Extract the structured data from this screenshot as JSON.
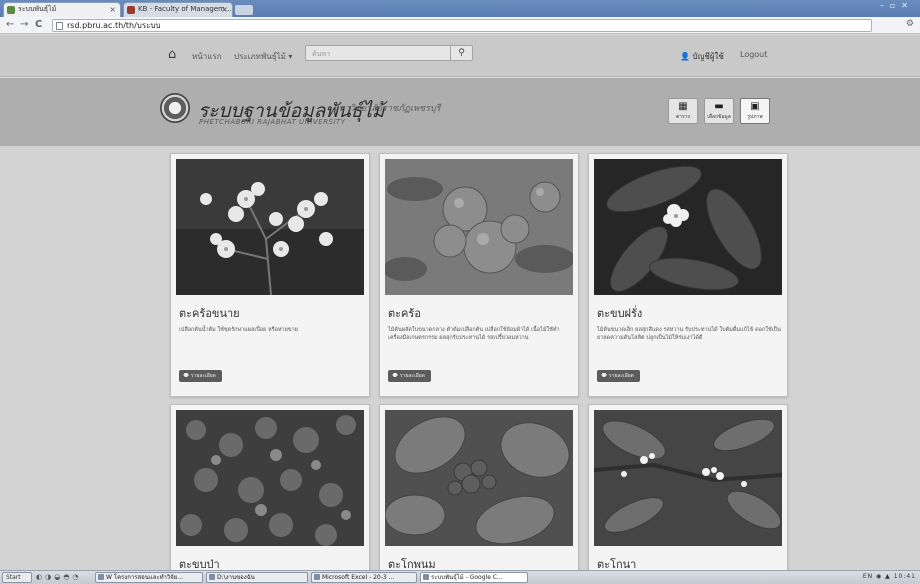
{
  "browser": {
    "tabs": [
      {
        "label": "ระบบพันธุ์ไม้"
      },
      {
        "label": "KB - Faculty of Managem..."
      }
    ],
    "address": "rsd.pbru.ac.th/th/บระบบ",
    "nav_back": "←",
    "nav_forward": "→",
    "nav_reload": "C"
  },
  "navbar": {
    "home_icon": "⌂",
    "links": [
      "หน้าแรก",
      "ประเภทพันธุ์ไม้ ▾"
    ],
    "search_placeholder": "ค้นหา",
    "search_button": "⚲",
    "user": "👤 บัญชีผู้ใช้",
    "logout": "Logout"
  },
  "banner": {
    "title": "ระบบฐานข้อมูลพันธุ์ไม้",
    "subtitle": "มหาวิทยาลัยราชภัฏเพชรบุรี",
    "university_en": "PHETCHABURI RAJABHAT UNIVERSITY",
    "view_buttons": [
      {
        "icon": "▦",
        "label": "ตาราง"
      },
      {
        "icon": "▬",
        "label": "เลือกข้อมูล"
      },
      {
        "icon": "▣",
        "label": "รูปภาพ"
      }
    ]
  },
  "cards": [
    {
      "title": "ตะคร้อขนาย",
      "desc": "เปลือกต้นน้ำต้ม ใช้ชุดรักษาแผลเปื่อย หรือหายขาย",
      "button": "รายละเอียด"
    },
    {
      "title": "ตะคร้อ",
      "desc": "ไม้ต้นผลัดใบขนาดกลาง ตำต้มเปลือกต้น เปลือกใช้ย้อมผ้าได้ เนื้อไม้ใช้ทำเครื่องมือเกษตรกรรม ผลสุกรับประทานได้ รสเปรี้ยวอมหวาน",
      "button": "รายละเอียด"
    },
    {
      "title": "ตะขบฝรั่ง",
      "desc": "ไม้ต้นขนาดเล็ก ผลสุกสีแดง รสหวาน รับประทานได้ ใบต้มดื่มแก้ไข้ ดอกใช้เป็นยาลดความดันโลหิต ปลูกเป็นไม้ให้ร่มเงาได้ดี",
      "button": "รายละเอียด"
    },
    {
      "title": "ตะขบป่า",
      "desc": "",
      "button": ""
    },
    {
      "title": "ตะโกพนม",
      "desc": "",
      "button": ""
    },
    {
      "title": "ตะโกนา",
      "desc": "",
      "button": ""
    }
  ],
  "taskbar": {
    "start": "Start",
    "tasks": [
      "W โครงการสอนและทำวิจัย...",
      "D:\\งานของฉัน",
      "Microsoft Excel - 20-3 ...",
      "ระบบพันธุ์ไม้ - Google C..."
    ],
    "tray": "EN ◉ ▲ 10:41"
  }
}
